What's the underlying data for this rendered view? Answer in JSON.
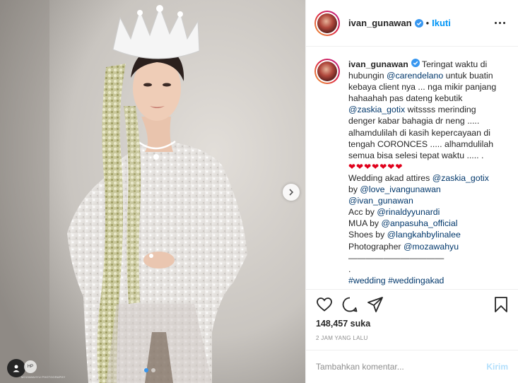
{
  "photo": {
    "watermark_text": "MOZAWAHYU PHOTOGRAPHY",
    "watermark_mark": "HP",
    "carousel": {
      "count": 2,
      "active": 0
    }
  },
  "header": {
    "username": "ivan_gunawan",
    "separator": "•",
    "follow_label": "Ikuti"
  },
  "caption": {
    "author": "ivan_gunawan",
    "lines": [
      {
        "parts": [
          {
            "t": " Teringat waktu di"
          }
        ]
      },
      {
        "parts": [
          {
            "t": "hubungin "
          },
          {
            "t": "@carendelano",
            "link": true
          },
          {
            "t": " untuk buatin"
          }
        ]
      },
      {
        "parts": [
          {
            "t": "kebaya client nya ... nga mikir panjang"
          }
        ]
      },
      {
        "parts": [
          {
            "t": "hahaahah pas dateng kebutik"
          }
        ]
      },
      {
        "parts": [
          {
            "t": "@zaskia_gotix",
            "link": true
          },
          {
            "t": " witssss merinding"
          }
        ]
      },
      {
        "parts": [
          {
            "t": "denger kabar bahagia dr neng ....."
          }
        ]
      },
      {
        "parts": [
          {
            "t": "alhamdulilah di kasih kepercayaan di"
          }
        ]
      },
      {
        "parts": [
          {
            "t": "tengah CORONCES ..... alhamdulilah"
          }
        ]
      },
      {
        "parts": [
          {
            "t": "semua bisa selesi tepat waktu ..... ."
          }
        ]
      },
      {
        "parts": [
          {
            "t": "❤❤❤❤❤❤❤",
            "hearts": true
          }
        ]
      },
      {
        "parts": [
          {
            "t": "Wedding akad attires "
          },
          {
            "t": "@zaskia_gotix",
            "link": true
          }
        ]
      },
      {
        "parts": [
          {
            "t": "by "
          },
          {
            "t": "@love_ivangunawan",
            "link": true
          }
        ]
      },
      {
        "parts": [
          {
            "t": "@ivan_gunawan",
            "link": true
          }
        ]
      },
      {
        "parts": [
          {
            "t": "Acc by "
          },
          {
            "t": "@rinaldyyunardi",
            "link": true
          }
        ]
      },
      {
        "parts": [
          {
            "t": "MUA by "
          },
          {
            "t": "@anpasuha_official",
            "link": true
          }
        ]
      },
      {
        "parts": [
          {
            "t": "Shoes by "
          },
          {
            "t": "@langkahbylinalee",
            "link": true
          }
        ]
      },
      {
        "parts": [
          {
            "t": "Photographer "
          },
          {
            "t": "@mozawahyu",
            "link": true
          }
        ]
      },
      {
        "parts": [
          {
            "t": "———————————"
          }
        ]
      },
      {
        "parts": [
          {
            "t": " "
          }
        ]
      },
      {
        "parts": [
          {
            "t": "."
          }
        ]
      },
      {
        "parts": [
          {
            "t": "#wedding",
            "link": true
          },
          {
            "t": " "
          },
          {
            "t": "#weddingakad",
            "link": true
          }
        ]
      }
    ]
  },
  "actions": {
    "icons": [
      "heart-icon",
      "comment-icon",
      "share-icon",
      "bookmark-icon"
    ]
  },
  "stats": {
    "likes": "148,457 suka",
    "time_ago": "2 JAM YANG LALU"
  },
  "comment": {
    "placeholder": "Tambahkan komentar...",
    "post_label": "Kirim"
  },
  "colors": {
    "link": "#00376b",
    "follow": "#0095f6",
    "verified": "#3897f0",
    "heart": "#e0001b",
    "post_disabled": "#b2dffc"
  }
}
